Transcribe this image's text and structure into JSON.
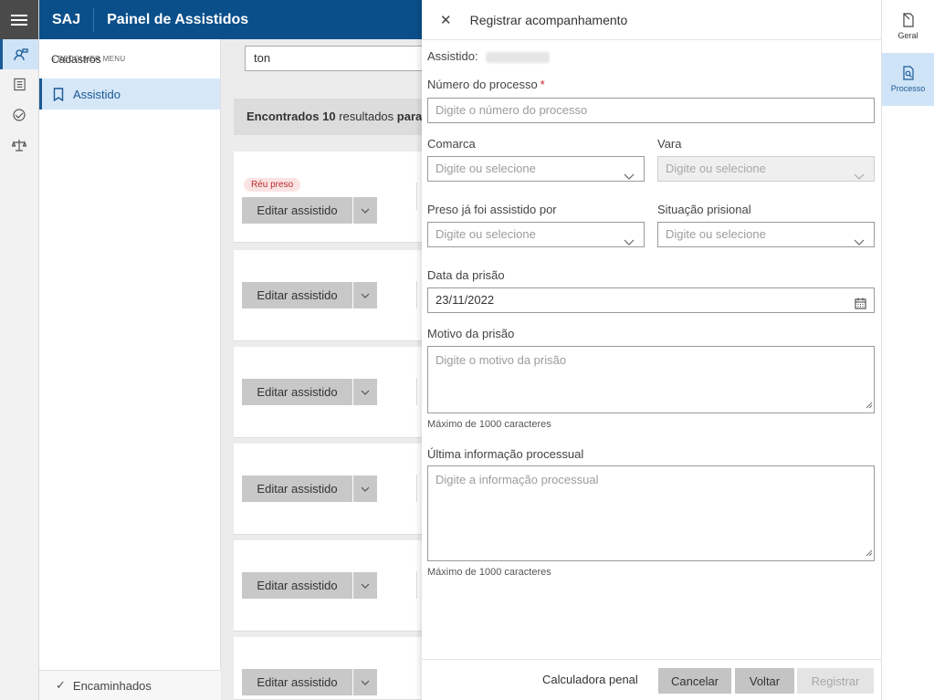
{
  "header": {
    "brand": "SAJ",
    "title": "Painel de Assistidos"
  },
  "sidebar": {
    "heading": "Cadastros",
    "collapse_label": "RECOLHER MENU",
    "items": [
      {
        "label": "Assistido"
      }
    ],
    "footer_label": "Encaminhados"
  },
  "main": {
    "search_value": "ton",
    "summary": {
      "prefix": "Encontrados",
      "count": "10",
      "middle": "resultados",
      "suffix": "para"
    },
    "cards": [
      {
        "badge": "Réu preso",
        "button_label": "Editar assistido"
      },
      {
        "badge": "",
        "button_label": "Editar assistido"
      },
      {
        "badge": "",
        "button_label": "Editar assistido"
      },
      {
        "badge": "",
        "button_label": "Editar assistido"
      },
      {
        "badge": "",
        "button_label": "Editar assistido"
      },
      {
        "badge": "",
        "button_label": "Editar assistido"
      }
    ]
  },
  "panel": {
    "title": "Registrar acompanhamento",
    "assistido_label": "Assistido:",
    "processo": {
      "label": "Número do processo",
      "required_mark": "*",
      "placeholder": "Digite o número do processo"
    },
    "comarca": {
      "label": "Comarca",
      "placeholder": "Digite ou selecione"
    },
    "vara": {
      "label": "Vara",
      "placeholder": "Digite ou selecione"
    },
    "preso_assistido": {
      "label": "Preso já foi assistido por",
      "placeholder": "Digite ou selecione"
    },
    "situacao": {
      "label": "Situação prisional",
      "placeholder": "Digite ou selecione"
    },
    "data_prisao": {
      "label": "Data da prisão",
      "value": "23/11/2022"
    },
    "motivo": {
      "label": "Motivo da prisão",
      "placeholder": "Digite o motivo da prisão",
      "hint": "Máximo de 1000 caracteres"
    },
    "ultima_info": {
      "label": "Última informação processual",
      "placeholder": "Digite a informação processual",
      "hint": "Máximo de 1000 caracteres"
    },
    "footer": {
      "calc_label": "Calculadora penal",
      "cancel_label": "Cancelar",
      "back_label": "Voltar",
      "register_label": "Registrar"
    }
  },
  "right_rail": {
    "tabs": [
      {
        "label": "Geral"
      },
      {
        "label": "Processo"
      }
    ]
  },
  "colors": {
    "header_bg": "#0b4f8a",
    "accent": "#1a5a96",
    "active_bg": "#cfe4f7",
    "required": "#d21c1c"
  }
}
